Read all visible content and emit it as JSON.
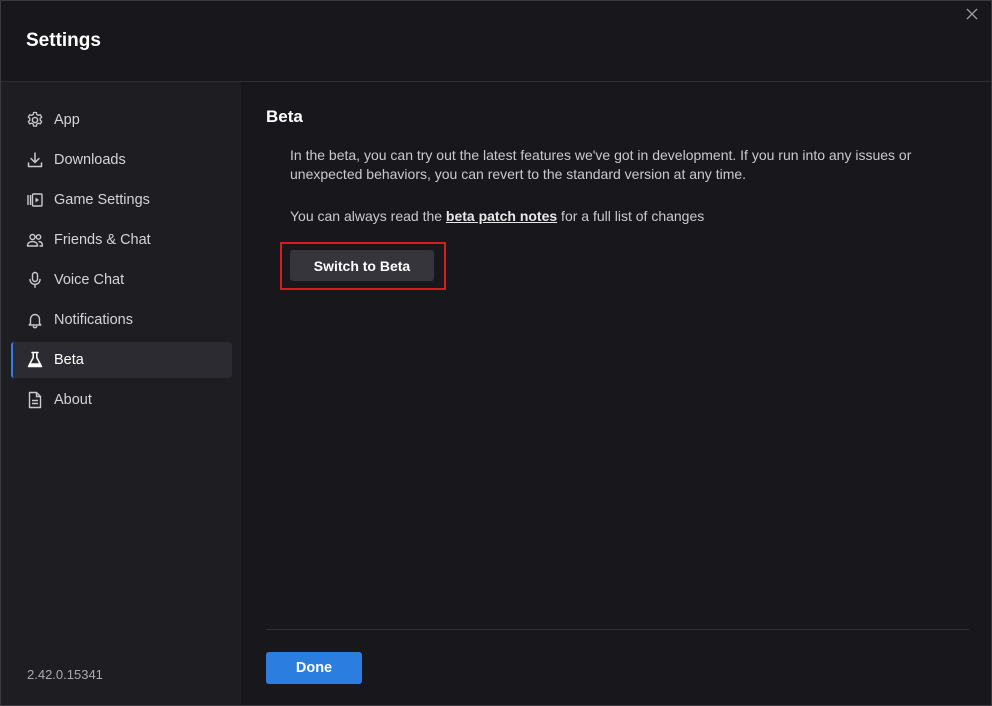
{
  "window": {
    "title": "Settings"
  },
  "sidebar": {
    "items": [
      {
        "label": "App",
        "icon": "gear-icon"
      },
      {
        "label": "Downloads",
        "icon": "download-icon"
      },
      {
        "label": "Game Settings",
        "icon": "game-settings-icon"
      },
      {
        "label": "Friends & Chat",
        "icon": "friends-icon"
      },
      {
        "label": "Voice Chat",
        "icon": "microphone-icon"
      },
      {
        "label": "Notifications",
        "icon": "bell-icon"
      },
      {
        "label": "Beta",
        "icon": "flask-icon",
        "active": true
      },
      {
        "label": "About",
        "icon": "document-icon"
      }
    ],
    "version": "2.42.0.15341"
  },
  "main": {
    "section_title": "Beta",
    "description": "In the beta, you can try out the latest features we've got in development. If you run into any issues or unexpected behaviors, you can revert to the standard version at any time.",
    "notes_prefix": "You can always read the ",
    "notes_link": "beta patch notes",
    "notes_suffix": " for a full list of changes",
    "switch_button": "Switch to Beta",
    "done_button": "Done"
  },
  "colors": {
    "background": "#18181c",
    "sidebar": "#1e1e22",
    "accent": "#2b7ddf",
    "highlight": "#d31f24"
  }
}
